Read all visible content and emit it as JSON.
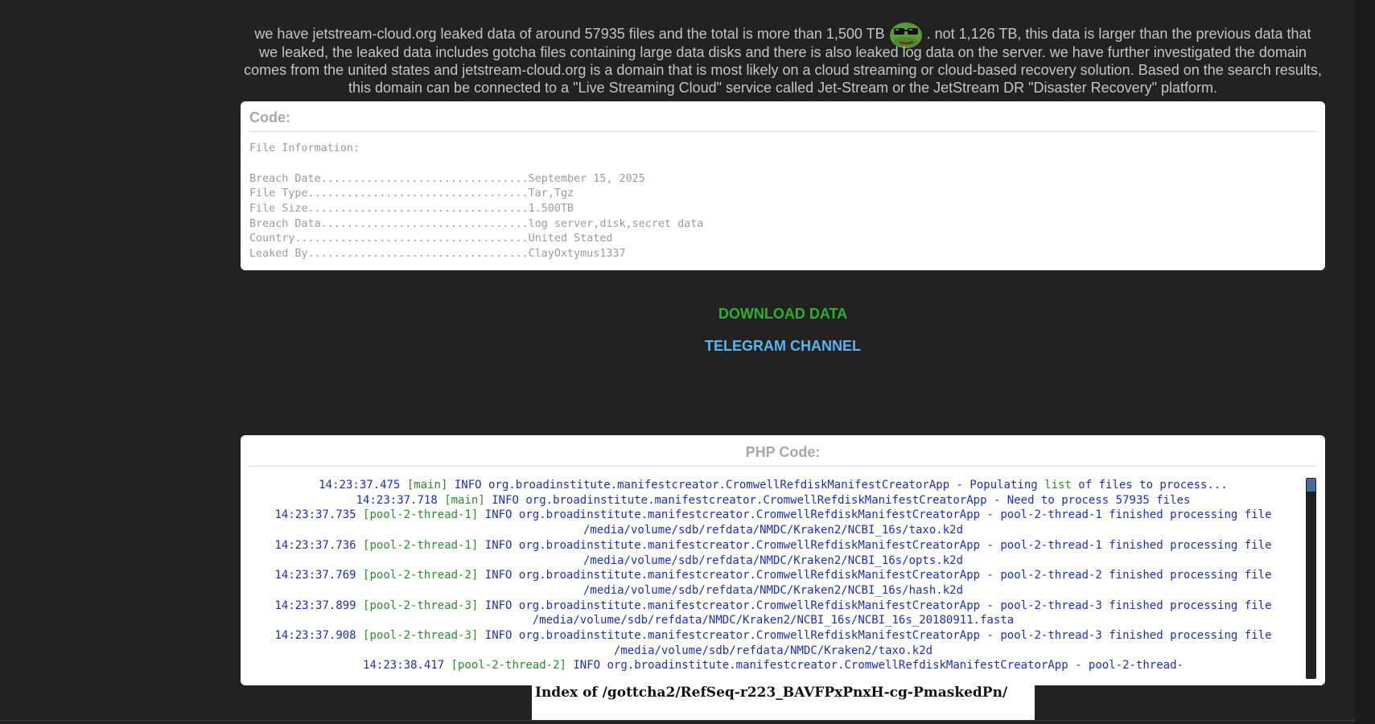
{
  "intro": {
    "part1": "we have jetstream-cloud.org leaked data of around 57935 files and the total is more than 1,500 TB",
    "part2": ". not 1,126 TB, this data is larger than the previous data that we leaked, the leaked data includes gotcha files containing large data disks and there is also leaked log data on the server. we have further investigated the domain comes from the united states and jetstream-cloud.org is a domain that is most likely on a cloud streaming or cloud-based recovery solution. Based on the search results, this domain can be connected to a \"Live Streaming Cloud\" service called Jet-Stream or the JetStream DR \"Disaster Recovery\" platform.",
    "emoji_icon": "pepe-sunglasses-icon"
  },
  "code_box": {
    "title": "Code:",
    "heading": "File Information:",
    "rows": [
      {
        "label": "Breach Date",
        "dots": "................................",
        "value": "September 15, 2025"
      },
      {
        "label": "File Type",
        "dots": "..................................",
        "value": "Tar,Tgz"
      },
      {
        "label": "File Size",
        "dots": "..................................",
        "value": "1.500TB"
      },
      {
        "label": "Breach Data",
        "dots": "................................",
        "value": "log server,disk,secret data"
      },
      {
        "label": "Country",
        "dots": "....................................",
        "value": "United Stated"
      },
      {
        "label": "Leaked By",
        "dots": "..................................",
        "value": "ClayOxtymus1337"
      }
    ]
  },
  "links": {
    "download": "DOWNLOAD DATA",
    "telegram": "TELEGRAM CHANNEL"
  },
  "php_box": {
    "title": "PHP Code:",
    "lines": [
      {
        "time": "14:23:37.475",
        "thread": "[main]",
        "text": " INFO  org.broadinstitute.manifestcreator.CromwellRefdiskManifestCreatorApp - Populating ",
        "kw": "list",
        "tail": " of files to process..."
      },
      {
        "time": "14:23:37.718",
        "thread": "[main]",
        "text": " INFO  org.broadinstitute.manifestcreator.CromwellRefdiskManifestCreatorApp - Need to process 57935 files",
        "kw": "",
        "tail": ""
      },
      {
        "time": "14:23:37.735",
        "thread": "[pool-2-thread-1]",
        "text": " INFO  org.broadinstitute.manifestcreator.CromwellRefdiskManifestCreatorApp - pool-2-thread-1 finished processing file /media/volume/sdb/refdata/NMDC/Kraken2/NCBI_16s/taxo.k2d",
        "kw": "",
        "tail": ""
      },
      {
        "time": "14:23:37.736",
        "thread": "[pool-2-thread-1]",
        "text": " INFO  org.broadinstitute.manifestcreator.CromwellRefdiskManifestCreatorApp - pool-2-thread-1 finished processing file /media/volume/sdb/refdata/NMDC/Kraken2/NCBI_16s/opts.k2d",
        "kw": "",
        "tail": ""
      },
      {
        "time": "14:23:37.769",
        "thread": "[pool-2-thread-2]",
        "text": " INFO  org.broadinstitute.manifestcreator.CromwellRefdiskManifestCreatorApp - pool-2-thread-2 finished processing file /media/volume/sdb/refdata/NMDC/Kraken2/NCBI_16s/hash.k2d",
        "kw": "",
        "tail": ""
      },
      {
        "time": "14:23:37.899",
        "thread": "[pool-2-thread-3]",
        "text": " INFO  org.broadinstitute.manifestcreator.CromwellRefdiskManifestCreatorApp - pool-2-thread-3 finished processing file /media/volume/sdb/refdata/NMDC/Kraken2/NCBI_16s/NCBI_16s_20180911.fasta",
        "kw": "",
        "tail": ""
      },
      {
        "time": "14:23:37.908",
        "thread": "[pool-2-thread-3]",
        "text": " INFO  org.broadinstitute.manifestcreator.CromwellRefdiskManifestCreatorApp - pool-2-thread-3 finished processing file /media/volume/sdb/refdata/NMDC/Kraken2/taxo.k2d",
        "kw": "",
        "tail": ""
      },
      {
        "time": "14:23:38.417",
        "thread": "[pool-2-thread-2]",
        "text": " INFO  org.broadinstitute.manifestcreator.CromwellRefdiskManifestCreatorApp - pool-2-thread-",
        "kw": "",
        "tail": ""
      }
    ]
  },
  "index_box": {
    "text": "Index of /gottcha2/RefSeq-r223_BAVFPxPnxH-cg-PmaskedPn/"
  }
}
